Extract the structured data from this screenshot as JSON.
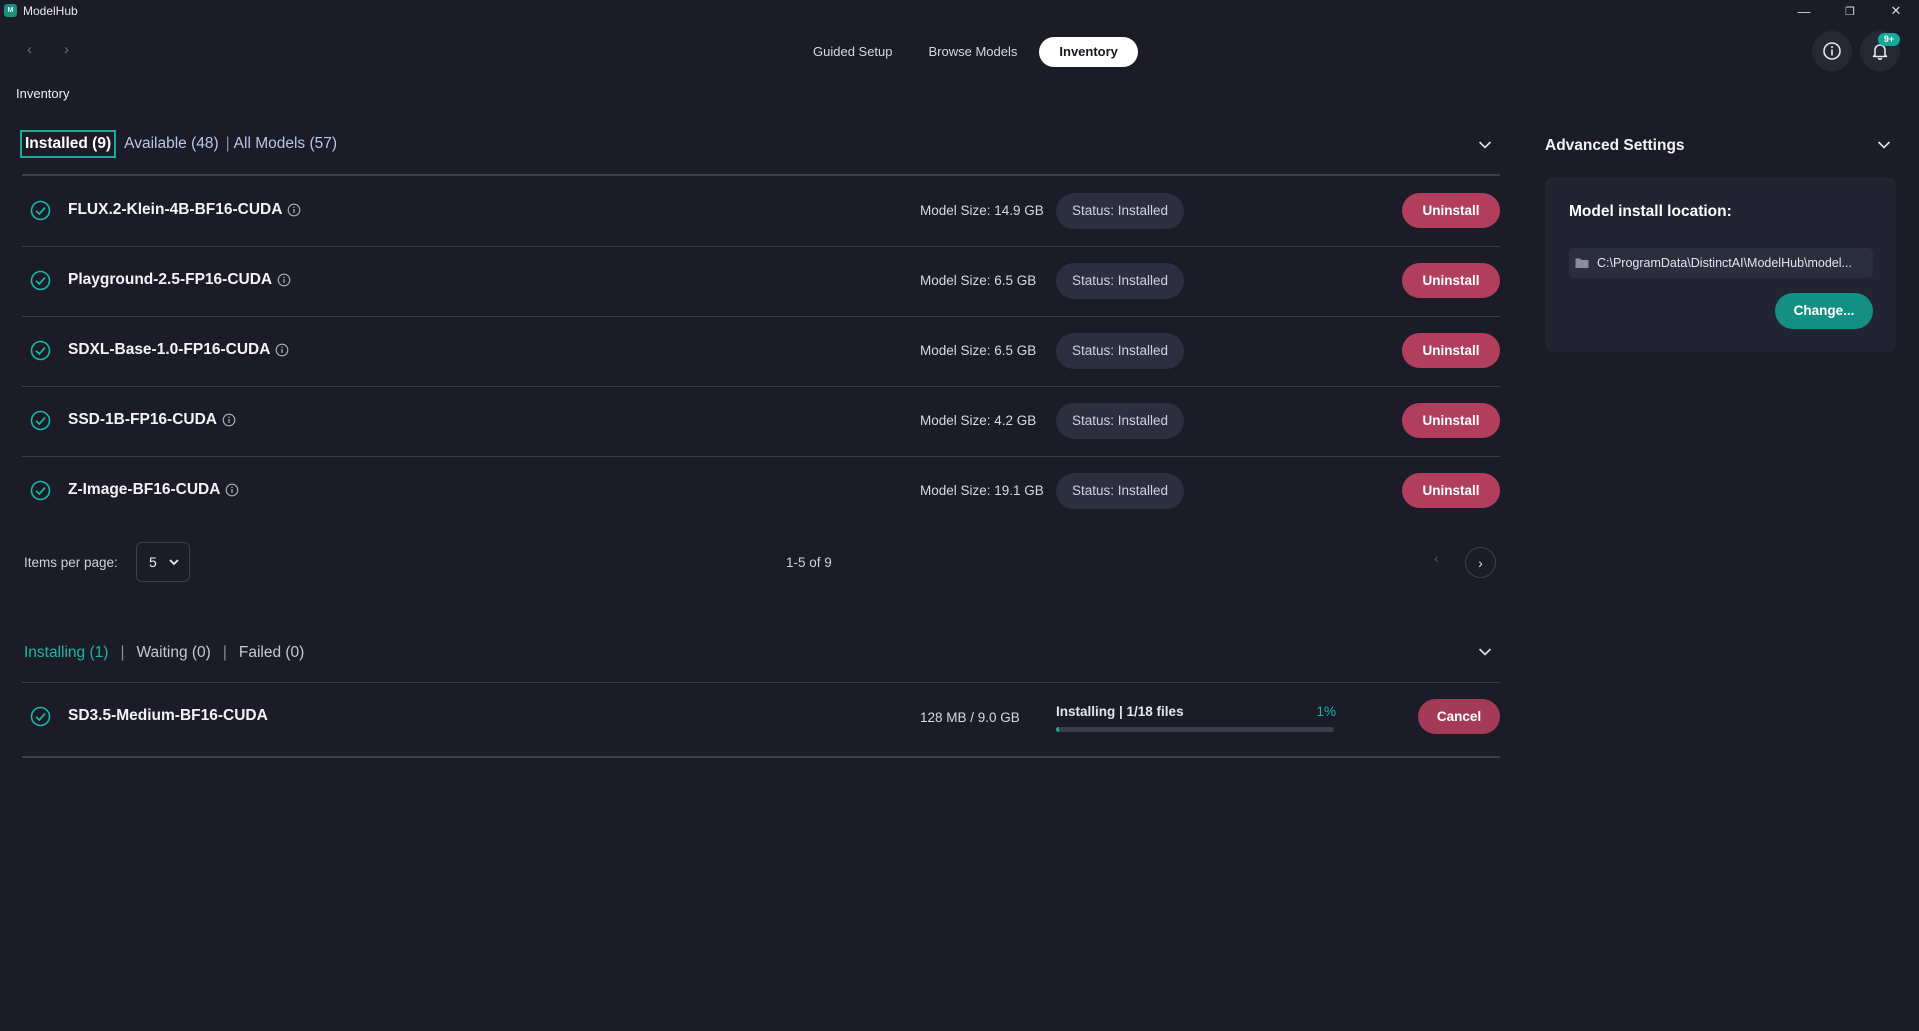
{
  "app": {
    "title": "ModelHub",
    "logo_text": "M"
  },
  "window_controls": {
    "minimize": "—",
    "restore": "❐",
    "close": "✕"
  },
  "nav": {
    "back": "‹",
    "forward": "›",
    "tabs": [
      {
        "label": "Guided Setup",
        "active": false
      },
      {
        "label": "Browse Models",
        "active": false
      },
      {
        "label": "Inventory",
        "active": true
      }
    ]
  },
  "header_actions": {
    "notifications_badge": "9+"
  },
  "page": {
    "title": "Inventory"
  },
  "filter_tabs": [
    {
      "label": "Installed (9)",
      "active": true
    },
    {
      "label": "Available (48)",
      "active": false
    },
    {
      "label": "All Models (57)",
      "active": false
    }
  ],
  "models": [
    {
      "name": "FLUX.2-Klein-4B-BF16-CUDA",
      "size": "Model Size: 14.9 GB",
      "status": "Status: Installed",
      "action": "Uninstall"
    },
    {
      "name": "Playground-2.5-FP16-CUDA",
      "size": "Model Size: 6.5 GB",
      "status": "Status: Installed",
      "action": "Uninstall"
    },
    {
      "name": "SDXL-Base-1.0-FP16-CUDA",
      "size": "Model Size: 6.5 GB",
      "status": "Status: Installed",
      "action": "Uninstall"
    },
    {
      "name": "SSD-1B-FP16-CUDA",
      "size": "Model Size: 4.2 GB",
      "status": "Status: Installed",
      "action": "Uninstall"
    },
    {
      "name": "Z-Image-BF16-CUDA",
      "size": "Model Size: 19.1 GB",
      "status": "Status: Installed",
      "action": "Uninstall"
    }
  ],
  "pagination": {
    "items_per_page_label": "Items per page:",
    "items_per_page": "5",
    "range": "1-5 of 9",
    "prev": "‹",
    "next": "›"
  },
  "queue_tabs": [
    {
      "label": "Installing (1)",
      "active": true
    },
    {
      "label": "Waiting (0)",
      "active": false
    },
    {
      "label": "Failed (0)",
      "active": false
    }
  ],
  "installing": [
    {
      "name": "SD3.5-Medium-BF16-CUDA",
      "size": "128 MB / 9.0 GB",
      "progress_label": "Installing | 1/18 files",
      "progress_pct": "1%",
      "progress": 0.01,
      "action": "Cancel"
    }
  ],
  "advanced_settings": {
    "title": "Advanced Settings",
    "install_location_label": "Model install location:",
    "path": "C:\\ProgramData\\DistinctAI\\ModelHub\\model...",
    "change_button": "Change..."
  },
  "colors": {
    "accent": "#17a99a",
    "danger": "#b03e5c",
    "background": "#1b1c27"
  }
}
